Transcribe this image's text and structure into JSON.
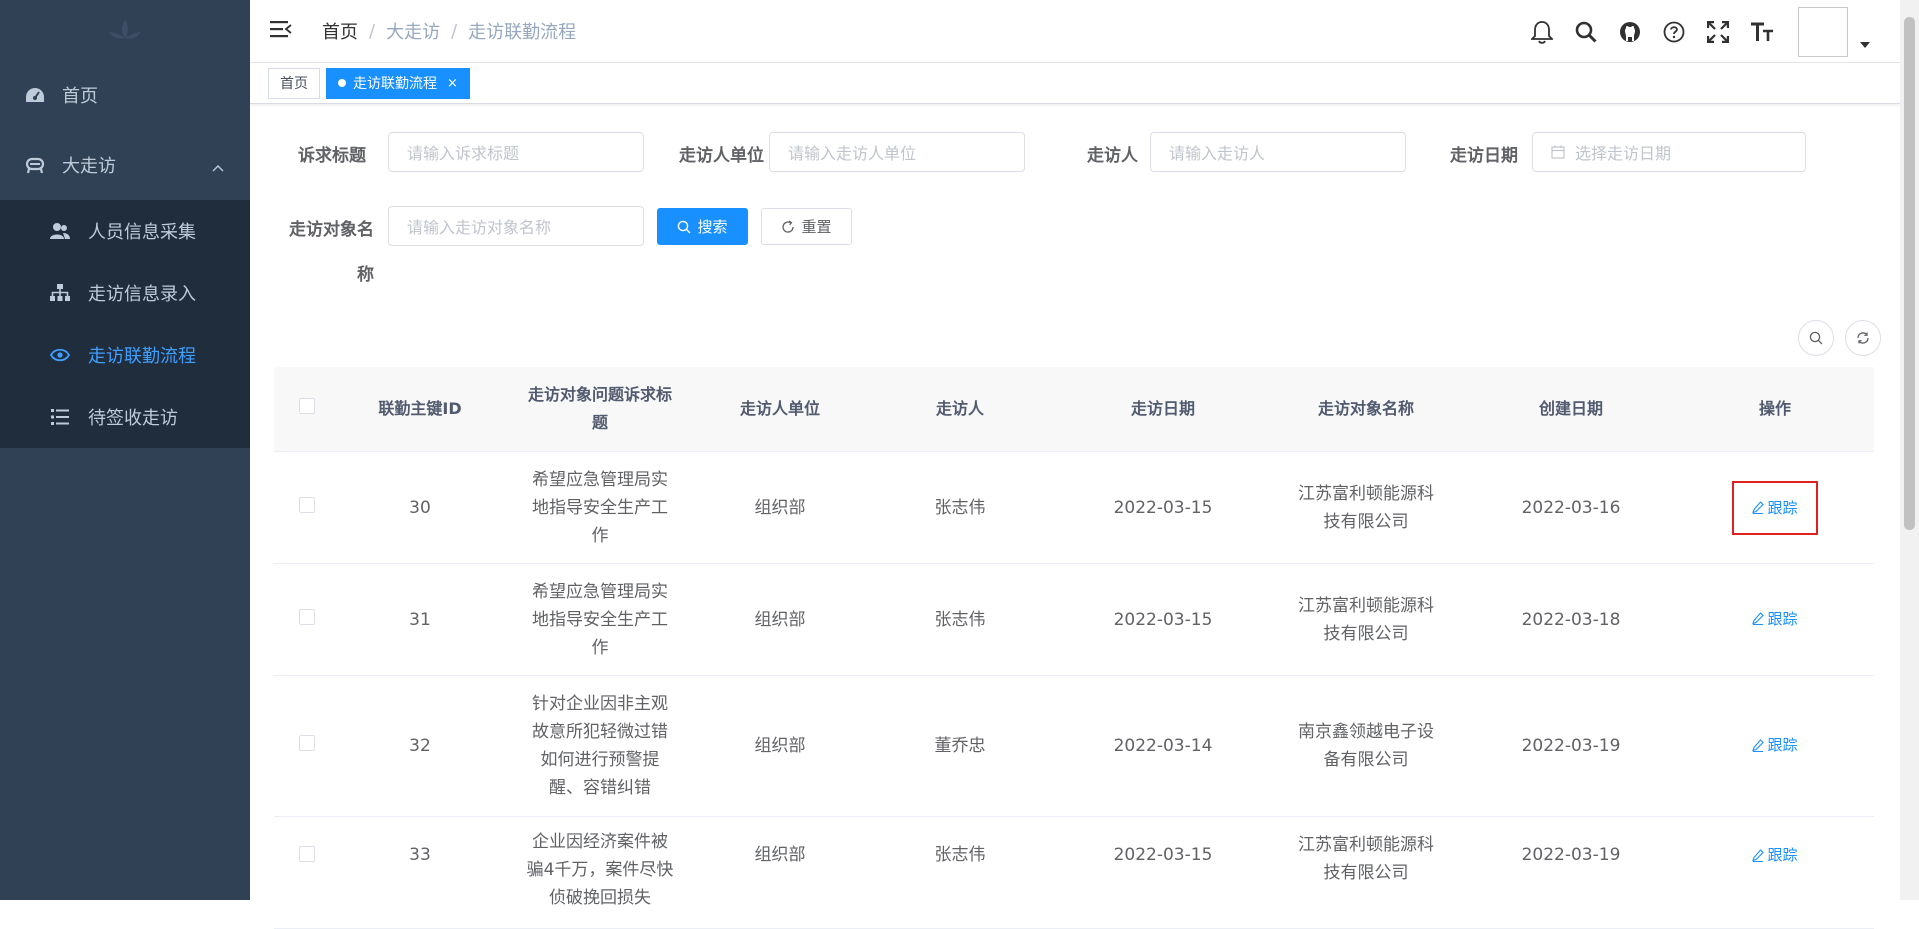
{
  "sidebar": {
    "items": [
      {
        "label": "首页",
        "icon": "dashboard-icon"
      },
      {
        "label": "大走访",
        "icon": "visit-icon",
        "expanded": true
      }
    ],
    "submenu": [
      {
        "label": "人员信息采集",
        "icon": "people-icon"
      },
      {
        "label": "走访信息录入",
        "icon": "tree-icon"
      },
      {
        "label": "走访联勤流程",
        "icon": "eye-icon",
        "active": true
      },
      {
        "label": "待签收走访",
        "icon": "list-icon"
      }
    ],
    "active_color": "#409eff",
    "bg_color": "#304156"
  },
  "navbar": {
    "breadcrumb": [
      "首页",
      "大走访",
      "走访联勤流程"
    ],
    "separator": "/"
  },
  "tags": {
    "items": [
      {
        "label": "首页"
      },
      {
        "label": "走访联勤流程",
        "active": true,
        "close": "×"
      }
    ]
  },
  "search": {
    "title_label": "诉求标题",
    "title_placeholder": "请输入诉求标题",
    "unit_label": "走访人单位",
    "unit_placeholder": "请输入走访人单位",
    "visitor_label": "走访人",
    "visitor_placeholder": "请输入走访人",
    "date_label": "走访日期",
    "date_placeholder": "选择走访日期",
    "target_label_line1": "走访对象名",
    "target_label_line2": "称",
    "target_placeholder": "请输入走访对象名称",
    "search_button": "搜索",
    "reset_button": "重置"
  },
  "table": {
    "headers": {
      "id": "联勤主键ID",
      "title": "走访对象问题诉求标题",
      "unit": "走访人单位",
      "visitor": "走访人",
      "visit_date": "走访日期",
      "target": "走访对象名称",
      "created": "创建日期",
      "action": "操作"
    },
    "action_label": "跟踪",
    "rows": [
      {
        "id": "30",
        "title": "希望应急管理局实地指导安全生产工作",
        "unit": "组织部",
        "visitor": "张志伟",
        "visit_date": "2022-03-15",
        "target": "江苏富利顿能源科技有限公司",
        "created": "2022-03-16",
        "highlighted": true
      },
      {
        "id": "31",
        "title": "希望应急管理局实地指导安全生产工作",
        "unit": "组织部",
        "visitor": "张志伟",
        "visit_date": "2022-03-15",
        "target": "江苏富利顿能源科技有限公司",
        "created": "2022-03-18"
      },
      {
        "id": "32",
        "title": "针对企业因非主观故意所犯轻微过错如何进行预警提醒、容错纠错",
        "unit": "组织部",
        "visitor": "董乔忠",
        "visit_date": "2022-03-14",
        "target": "南京鑫领越电子设备有限公司",
        "created": "2022-03-19"
      },
      {
        "id": "33",
        "title": "企业因经济案件被骗4千万，案件尽快侦破挽回损失",
        "unit": "组织部",
        "visitor": "张志伟",
        "visit_date": "2022-03-15",
        "target": "江苏富利顿能源科技有限公司",
        "created": "2022-03-19"
      }
    ]
  },
  "colors": {
    "primary": "#1890ff",
    "highlight_border": "#e02020"
  }
}
